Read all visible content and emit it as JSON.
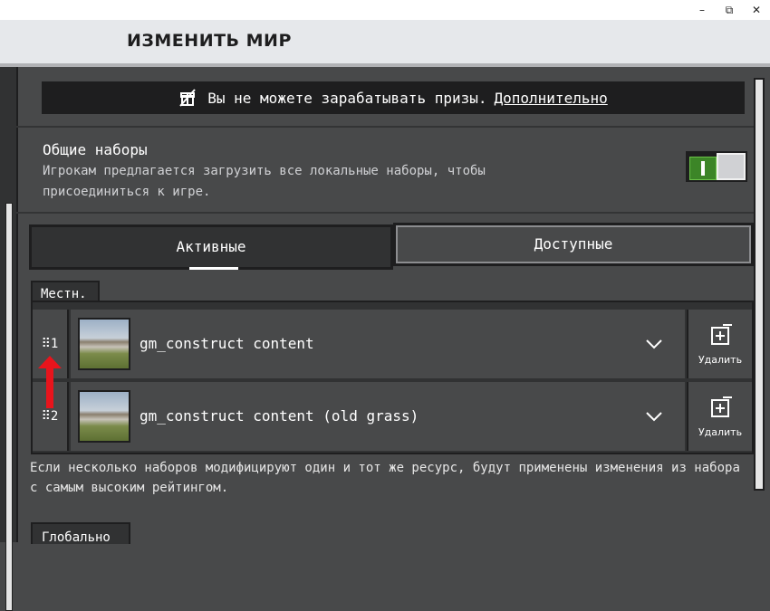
{
  "window": {
    "minimize": "–",
    "maximize": "⧉",
    "close": "✕"
  },
  "header": {
    "title": "ИЗМЕНИТЬ МИР"
  },
  "banner": {
    "icon": "gift-crossed-icon",
    "text": "Вы не можете зарабатывать призы.",
    "link": "Дополнительно"
  },
  "shared_packs": {
    "title": "Общие наборы",
    "description": "Игрокам предлагается загрузить все локальные наборы, чтобы присоединиться к игре.",
    "toggle_on": true
  },
  "tabs": {
    "active": "Активные",
    "available": "Доступные"
  },
  "local_label": "Местн.",
  "packs": [
    {
      "rank": "1",
      "name": "gm_construct content",
      "delete_label": "Удалить"
    },
    {
      "rank": "2",
      "name": "gm_construct content (old grass)",
      "delete_label": "Удалить"
    }
  ],
  "info": "Если несколько наборов модифицируют один и тот же ресурс, будут применены изменения из набора с самым высоким рейтингом.",
  "global_label": "Глобально",
  "colors": {
    "accent_green": "#3c8527",
    "annotation_red": "#e8141c"
  }
}
